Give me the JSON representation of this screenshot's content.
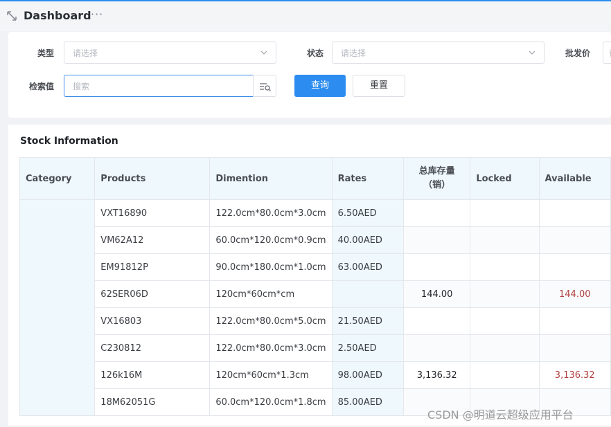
{
  "header": {
    "title": "Dashboard",
    "more": "···",
    "expand_icon": "expand-arrows-icon"
  },
  "filters": {
    "type_label": "类型",
    "type_placeholder": "请选择",
    "status_label": "状态",
    "status_placeholder": "请选择",
    "wholesale_label": "批发价",
    "wholesale_placeholder": "请",
    "search_label": "检索值",
    "search_placeholder": "搜索",
    "search_icon": "search-list-icon",
    "query_button": "查询",
    "reset_button": "重置"
  },
  "table": {
    "title": "Stock Information",
    "columns": [
      "Category",
      "Products",
      "Dimention",
      "Rates",
      "总库存量（销）",
      "Locked",
      "Available"
    ],
    "rows": [
      {
        "category": "",
        "product": "VXT16890",
        "dimension": "122.0cm*80.0cm*3.0cm",
        "rate": "6.50AED",
        "total": "",
        "locked": "",
        "available": ""
      },
      {
        "category": "",
        "product": "VM62A12",
        "dimension": "60.0cm*120.0cm*0.9cm",
        "rate": "40.00AED",
        "total": "",
        "locked": "",
        "available": ""
      },
      {
        "category": "",
        "product": "EM91812P",
        "dimension": "90.0cm*180.0cm*1.0cm",
        "rate": "63.00AED",
        "total": "",
        "locked": "",
        "available": ""
      },
      {
        "category": "",
        "product": "62SER06D",
        "dimension": "120cm*60cm*cm",
        "rate": "",
        "total": "144.00",
        "locked": "",
        "available": "144.00"
      },
      {
        "category": "",
        "product": "VX16803",
        "dimension": "122.0cm*80.0cm*5.0cm",
        "rate": "21.50AED",
        "total": "",
        "locked": "",
        "available": ""
      },
      {
        "category": "",
        "product": "C230812",
        "dimension": "122.0cm*80.0cm*3.0cm",
        "rate": "2.50AED",
        "total": "",
        "locked": "",
        "available": ""
      },
      {
        "category": "",
        "product": "126k16M",
        "dimension": "120cm*60cm*1.3cm",
        "rate": "98.00AED",
        "total": "3,136.32",
        "locked": "",
        "available": "3,136.32"
      },
      {
        "category": "",
        "product": "18M62051G",
        "dimension": "60.0cm*120.0cm*1.8cm",
        "rate": "85.00AED",
        "total": "",
        "locked": "",
        "available": ""
      }
    ]
  },
  "watermark": "CSDN @明道云超级应用平台",
  "colors": {
    "accent": "#2d8cf0",
    "header_bg": "#eef8fd",
    "available_text": "#b0403f"
  }
}
